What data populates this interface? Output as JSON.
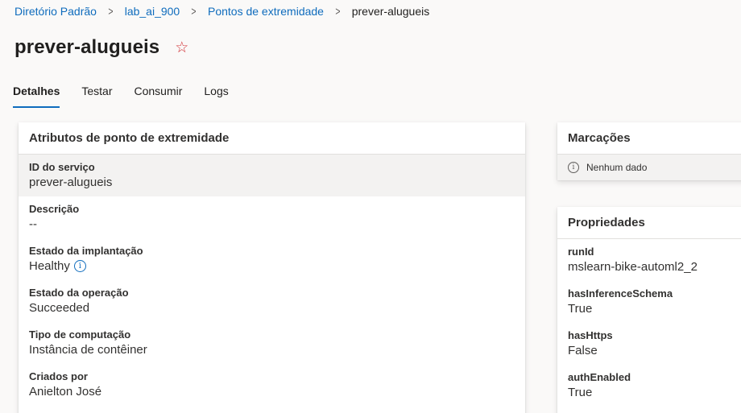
{
  "breadcrumb": {
    "items": [
      "Diretório Padrão",
      "lab_ai_900",
      "Pontos de extremidade"
    ],
    "current": "prever-alugueis"
  },
  "page": {
    "title": "prever-alugueis"
  },
  "tabs": [
    {
      "label": "Detalhes",
      "active": true
    },
    {
      "label": "Testar",
      "active": false
    },
    {
      "label": "Consumir",
      "active": false
    },
    {
      "label": "Logs",
      "active": false
    }
  ],
  "attributes": {
    "title": "Atributos de ponto de extremidade",
    "rows": [
      {
        "label": "ID do serviço",
        "value": "prever-alugueis"
      },
      {
        "label": "Descrição",
        "value": "--"
      },
      {
        "label": "Estado da implantação",
        "value": "Healthy"
      },
      {
        "label": "Estado da operação",
        "value": "Succeeded"
      },
      {
        "label": "Tipo de computação",
        "value": "Instância de contêiner"
      },
      {
        "label": "Criados por",
        "value": "Anielton José"
      }
    ]
  },
  "tags": {
    "title": "Marcações",
    "empty_text": "Nenhum dado"
  },
  "properties": {
    "title": "Propriedades",
    "rows": [
      {
        "label": "runId",
        "value": "mslearn-bike-automl2_2"
      },
      {
        "label": "hasInferenceSchema",
        "value": "True"
      },
      {
        "label": "hasHttps",
        "value": "False"
      },
      {
        "label": "authEnabled",
        "value": "True"
      }
    ]
  },
  "colors": {
    "accent": "#0f6cbd",
    "favorite": "#d13438"
  },
  "icons": {
    "favorite": "star-outline-icon",
    "info": "info-icon",
    "separator": "chevron-right-icon"
  }
}
